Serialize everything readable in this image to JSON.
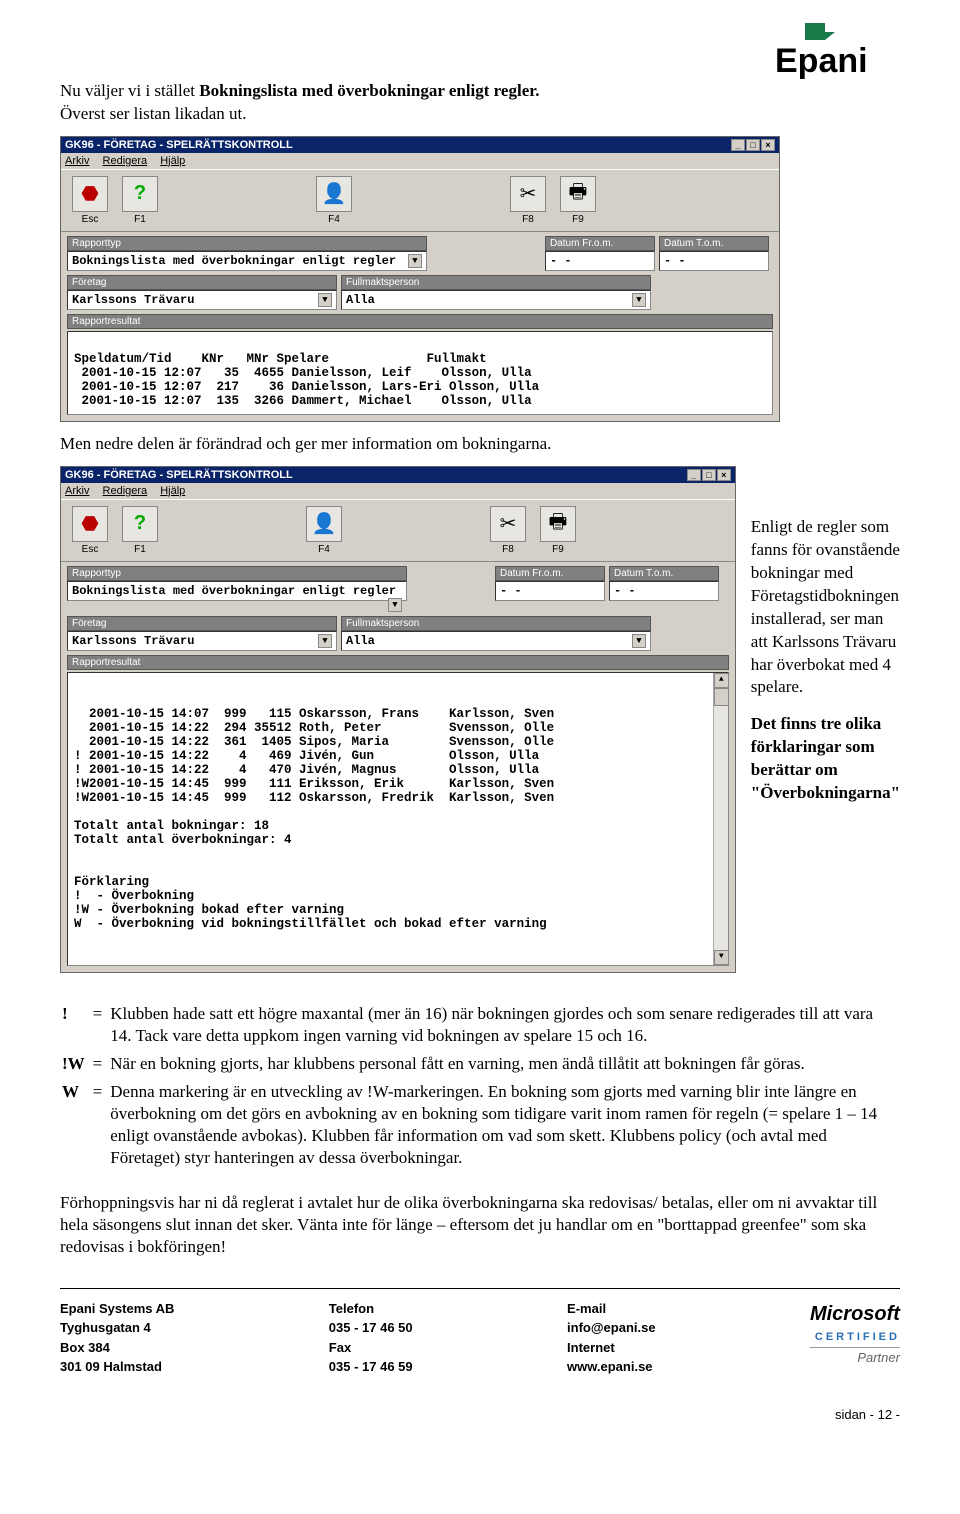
{
  "logo_text": "Epani",
  "intro_line1a": "Nu väljer vi i stället ",
  "intro_line1b": "Bokningslista med överbokningar enligt regler.",
  "intro_line2": "Överst ser listan likadan ut.",
  "window": {
    "title": "GK96 - FÖRETAG - SPELRÄTTSKONTROLL",
    "menu": [
      "Arkiv",
      "Redigera",
      "Hjälp"
    ],
    "tools": [
      {
        "icon": "⬣",
        "label": "Esc",
        "color": "#b00"
      },
      {
        "icon": "?",
        "label": "F1",
        "color": "#0a0"
      },
      {
        "icon": "👤",
        "label": "F4",
        "color": "#333"
      },
      {
        "icon": "✂",
        "label": "F8",
        "color": "#555"
      },
      {
        "icon": "🖶",
        "label": "F9",
        "color": "#333"
      }
    ],
    "labels": {
      "rapporttyp": "Rapporttyp",
      "datum_from": "Datum Fr.o.m.",
      "datum_tom": "Datum T.o.m.",
      "foretag": "Företag",
      "fullmakt": "Fullmaktsperson",
      "rapportresultat": "Rapportresultat"
    },
    "values": {
      "rapporttyp": "Bokningslista med överbokningar enligt regler",
      "datum_from": "  -  -",
      "datum_tom": "  -  -",
      "foretag": "Karlssons Trävaru",
      "fullmakt": "Alla"
    }
  },
  "report1_header": "Speldatum/Tid    KNr   MNr Spelare             Fullmakt",
  "report1_rows": [
    " 2001-10-15 12:07   35  4655 Danielsson, Leif    Olsson, Ulla",
    " 2001-10-15 12:07  217    36 Danielsson, Lars-Eri Olsson, Ulla",
    " 2001-10-15 12:07  135  3266 Dammert, Michael    Olsson, Ulla"
  ],
  "midtext": "Men nedre delen är förändrad och ger mer information om bokningarna.",
  "report2_rows": [
    "  2001-10-15 14:07  999   115 Oskarsson, Frans    Karlsson, Sven",
    "  2001-10-15 14:22  294 35512 Roth, Peter         Svensson, Olle",
    "  2001-10-15 14:22  361  1405 Sipos, Maria        Svensson, Olle",
    "! 2001-10-15 14:22    4   469 Jivén, Gun          Olsson, Ulla",
    "! 2001-10-15 14:22    4   470 Jivén, Magnus       Olsson, Ulla",
    "!W2001-10-15 14:45  999   111 Eriksson, Erik      Karlsson, Sven",
    "!W2001-10-15 14:45  999   112 Oskarsson, Fredrik  Karlsson, Sven",
    "",
    "Totalt antal bokningar: 18",
    "Totalt antal överbokningar: 4",
    "",
    "",
    "Förklaring",
    "!  - Överbokning",
    "!W - Överbokning bokad efter varning",
    "W  - Överbokning vid bokningstillfället och bokad efter varning"
  ],
  "side1": "Enligt de regler som fanns för ovanstående bokningar med Företagstidbokningen installerad, ser man att Karlssons Trävaru har överbokat med 4 spelare.",
  "side2": "Det finns tre olika förklaringar som berättar om \"Överbokningarna\"",
  "legend": [
    {
      "k": "!",
      "v": "Klubben hade satt ett högre maxantal (mer än 16) när bokningen gjordes och som senare redigerades till att vara 14. Tack vare detta uppkom ingen varning vid bokningen av spelare 15 och 16."
    },
    {
      "k": "!W",
      "v": "När en bokning gjorts, har klubbens personal fått en varning, men ändå tillåtit att bokningen får göras."
    },
    {
      "k": "W",
      "v": "Denna markering är en utveckling av !W-markeringen. En bokning som gjorts med varning blir inte längre en överbokning om det görs en avbokning av en bokning som tidigare varit inom ramen för regeln (= spelare 1 – 14 enligt ovanstående avbokas). Klubben får information om vad som skett. Klubbens policy (och avtal med Företaget) styr hanteringen av dessa överbokningar."
    }
  ],
  "closing": "Förhoppningsvis har ni då reglerat i avtalet hur de olika överbokningarna ska redovisas/ betalas, eller om ni avvaktar till hela säsongens slut innan det sker. Vänta inte för länge – eftersom det ju handlar om en \"borttappad greenfee\" som ska redovisas i bokföringen!",
  "footer": {
    "company": {
      "h": "Epani Systems AB",
      "l1": "Tyghusgatan 4",
      "l2": "Box 384",
      "l3": "301 09  Halmstad"
    },
    "phone": {
      "h": "Telefon",
      "l1": "035 - 17 46 50",
      "h2": "Fax",
      "l2": "035 - 17 46 59"
    },
    "net": {
      "h": "E-mail",
      "l1": "info@epani.se",
      "h2": "Internet",
      "l2": "www.epani.se"
    },
    "ms1": "Microsoft",
    "ms2": "CERTIFIED",
    "ms3": "Partner"
  },
  "pagenum": "sidan - 12 -"
}
